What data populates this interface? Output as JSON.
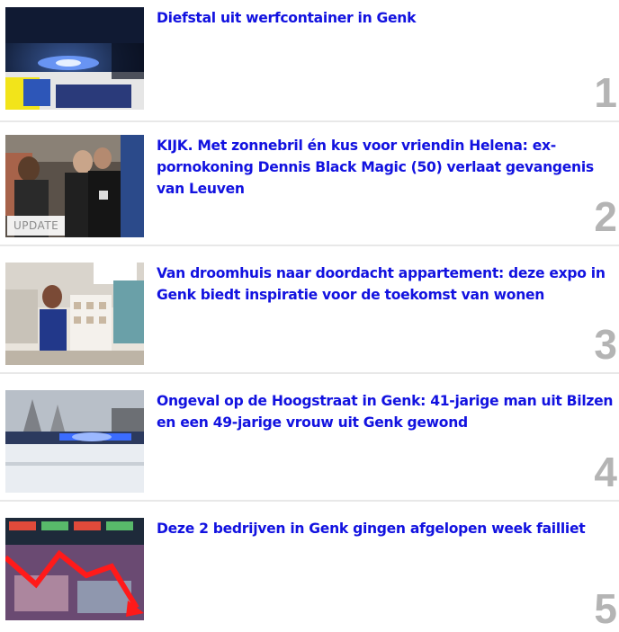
{
  "articles": [
    {
      "title": "Diefstal uit werfcontainer in Genk",
      "rank": "1",
      "thumbnail": "police-car-photo",
      "badge": null
    },
    {
      "title": "KIJK. Met zonnebril én kus voor vriendin Helena: ex-pornokoning Dennis Black Magic (50) verlaat gevangenis van Leuven",
      "rank": "2",
      "thumbnail": "people-embrace-photo",
      "badge": "UPDATE"
    },
    {
      "title": "Van droomhuis naar doordacht appartement: deze expo in Genk biedt inspiratie voor de toekomst van wonen",
      "rank": "3",
      "thumbnail": "woman-at-expo-photo",
      "badge": null
    },
    {
      "title": "Ongeval op de Hoogstraat in Genk: 41-jarige man uit Bilzen en een 49-jarige vrouw uit Genk gewond",
      "rank": "4",
      "thumbnail": "emergency-vehicle-photo",
      "badge": null
    },
    {
      "title": "Deze 2 bedrijven in Genk gingen afgelopen week failliet",
      "rank": "5",
      "thumbnail": "stock-chart-falling-photo",
      "badge": null
    }
  ],
  "colors": {
    "headline": "#1212e0",
    "rank": "#b4b4b4",
    "divider": "#e8e8e8"
  }
}
